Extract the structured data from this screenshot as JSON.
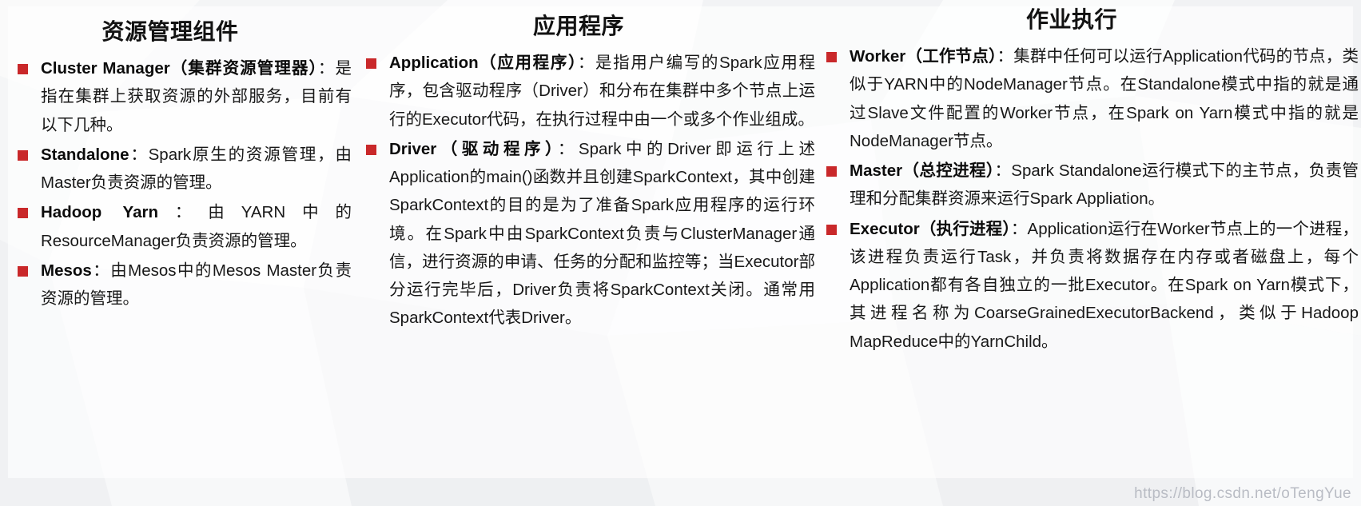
{
  "slide": {
    "bullet_color": "#c9282a",
    "title_color": "#121212",
    "text_color": "#181818",
    "panel_background": "#ffffff",
    "page_background": "#f3f4f6",
    "watermark": "https://blog.csdn.net/oTengYue"
  },
  "columns": [
    {
      "title": "资源管理组件",
      "bullets": [
        {
          "term": "Cluster Manager（集群资源管理器）",
          "body": "：是指在集群上获取资源的外部服务，目前有以下几种。"
        },
        {
          "term": "Standalone",
          "body": "：Spark原生的资源管理，由Master负责资源的管理。"
        },
        {
          "term": "Hadoop Yarn",
          "body": "：由YARN中的ResourceManager负责资源的管理。"
        },
        {
          "term": "Mesos",
          "body": "：由Mesos中的Mesos Master负责资源的管理。"
        }
      ]
    },
    {
      "title": "应用程序",
      "bullets": [
        {
          "term": "Application（应用程序）",
          "body": "：是指用户编写的Spark应用程序，包含驱动程序（Driver）和分布在集群中多个节点上运行的Executor代码，在执行过程中由一个或多个作业组成。"
        },
        {
          "term": "Driver（驱动程序）",
          "body": "：Spark中的Driver即运行上述Application的main()函数并且创建SparkContext，其中创建SparkContext的目的是为了准备Spark应用程序的运行环境。在Spark中由SparkContext负责与ClusterManager通信，进行资源的申请、任务的分配和监控等；当Executor部分运行完毕后，Driver负责将SparkContext关闭。通常用SparkContext代表Driver。"
        }
      ]
    },
    {
      "title": "作业执行",
      "bullets": [
        {
          "term": "Worker（工作节点）",
          "body": "：集群中任何可以运行Application代码的节点，类似于YARN中的NodeManager节点。在Standalone模式中指的就是通过Slave文件配置的Worker节点，在Spark on Yarn模式中指的就是NodeManager节点。"
        },
        {
          "term": "Master（总控进程）",
          "body": "：Spark Standalone运行模式下的主节点，负责管理和分配集群资源来运行Spark Appliation。"
        },
        {
          "term": "Executor（执行进程）",
          "body": "：Application运行在Worker节点上的一个进程，该进程负责运行Task，并负责将数据存在内存或者磁盘上，每个Application都有各自独立的一批Executor。在Spark on Yarn模式下，其进程名称为CoarseGrainedExecutorBackend，类似于Hadoop MapReduce中的YarnChild。"
        }
      ]
    }
  ]
}
